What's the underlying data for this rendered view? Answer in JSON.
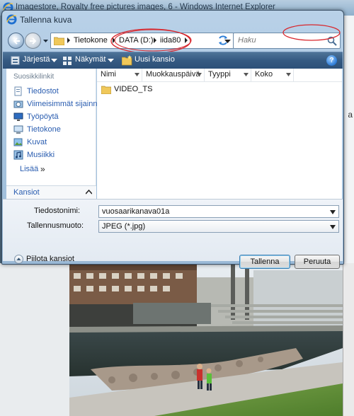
{
  "background_window": {
    "title": "Imagestore, Royalty free pictures images, 6 - Windows Internet Explorer",
    "right_edge_char": "a"
  },
  "dialog": {
    "title": "Tallenna kuva",
    "address": {
      "crumbs": [
        "Tietokone",
        "DATA (D:)",
        "iida80"
      ]
    },
    "search": {
      "placeholder": "Haku"
    },
    "toolbar": {
      "organize": "Järjestä",
      "views": "Näkymät",
      "new_folder": "Uusi kansio"
    },
    "sidebar": {
      "header": "Suosikkilinkit",
      "items": [
        {
          "label": "Tiedostot",
          "icon": "documents-icon"
        },
        {
          "label": "Viimeisimmät sijainnit",
          "icon": "recent-places-icon"
        },
        {
          "label": "Työpöytä",
          "icon": "desktop-icon"
        },
        {
          "label": "Tietokone",
          "icon": "computer-icon"
        },
        {
          "label": "Kuvat",
          "icon": "pictures-icon"
        },
        {
          "label": "Musiikki",
          "icon": "music-icon"
        }
      ],
      "more": "Lisää",
      "more_arrow": "»",
      "folders_label": "Kansiot"
    },
    "file_list": {
      "columns": [
        "Nimi",
        "Muokkauspäivä",
        "Tyyppi",
        "Koko"
      ],
      "rows": [
        {
          "name": "VIDEO_TS",
          "icon": "folder-icon"
        }
      ]
    },
    "form": {
      "filename_label": "Tiedostonimi:",
      "filename_value": "vuosaarikanava01a",
      "filetype_label": "Tallennusmuoto:",
      "filetype_value": "JPEG (*.jpg)"
    },
    "hide_folders": "Piilota kansiot",
    "save_button": "Tallenna",
    "cancel_button": "Peruuta",
    "annotation_color": "#d8262c"
  }
}
